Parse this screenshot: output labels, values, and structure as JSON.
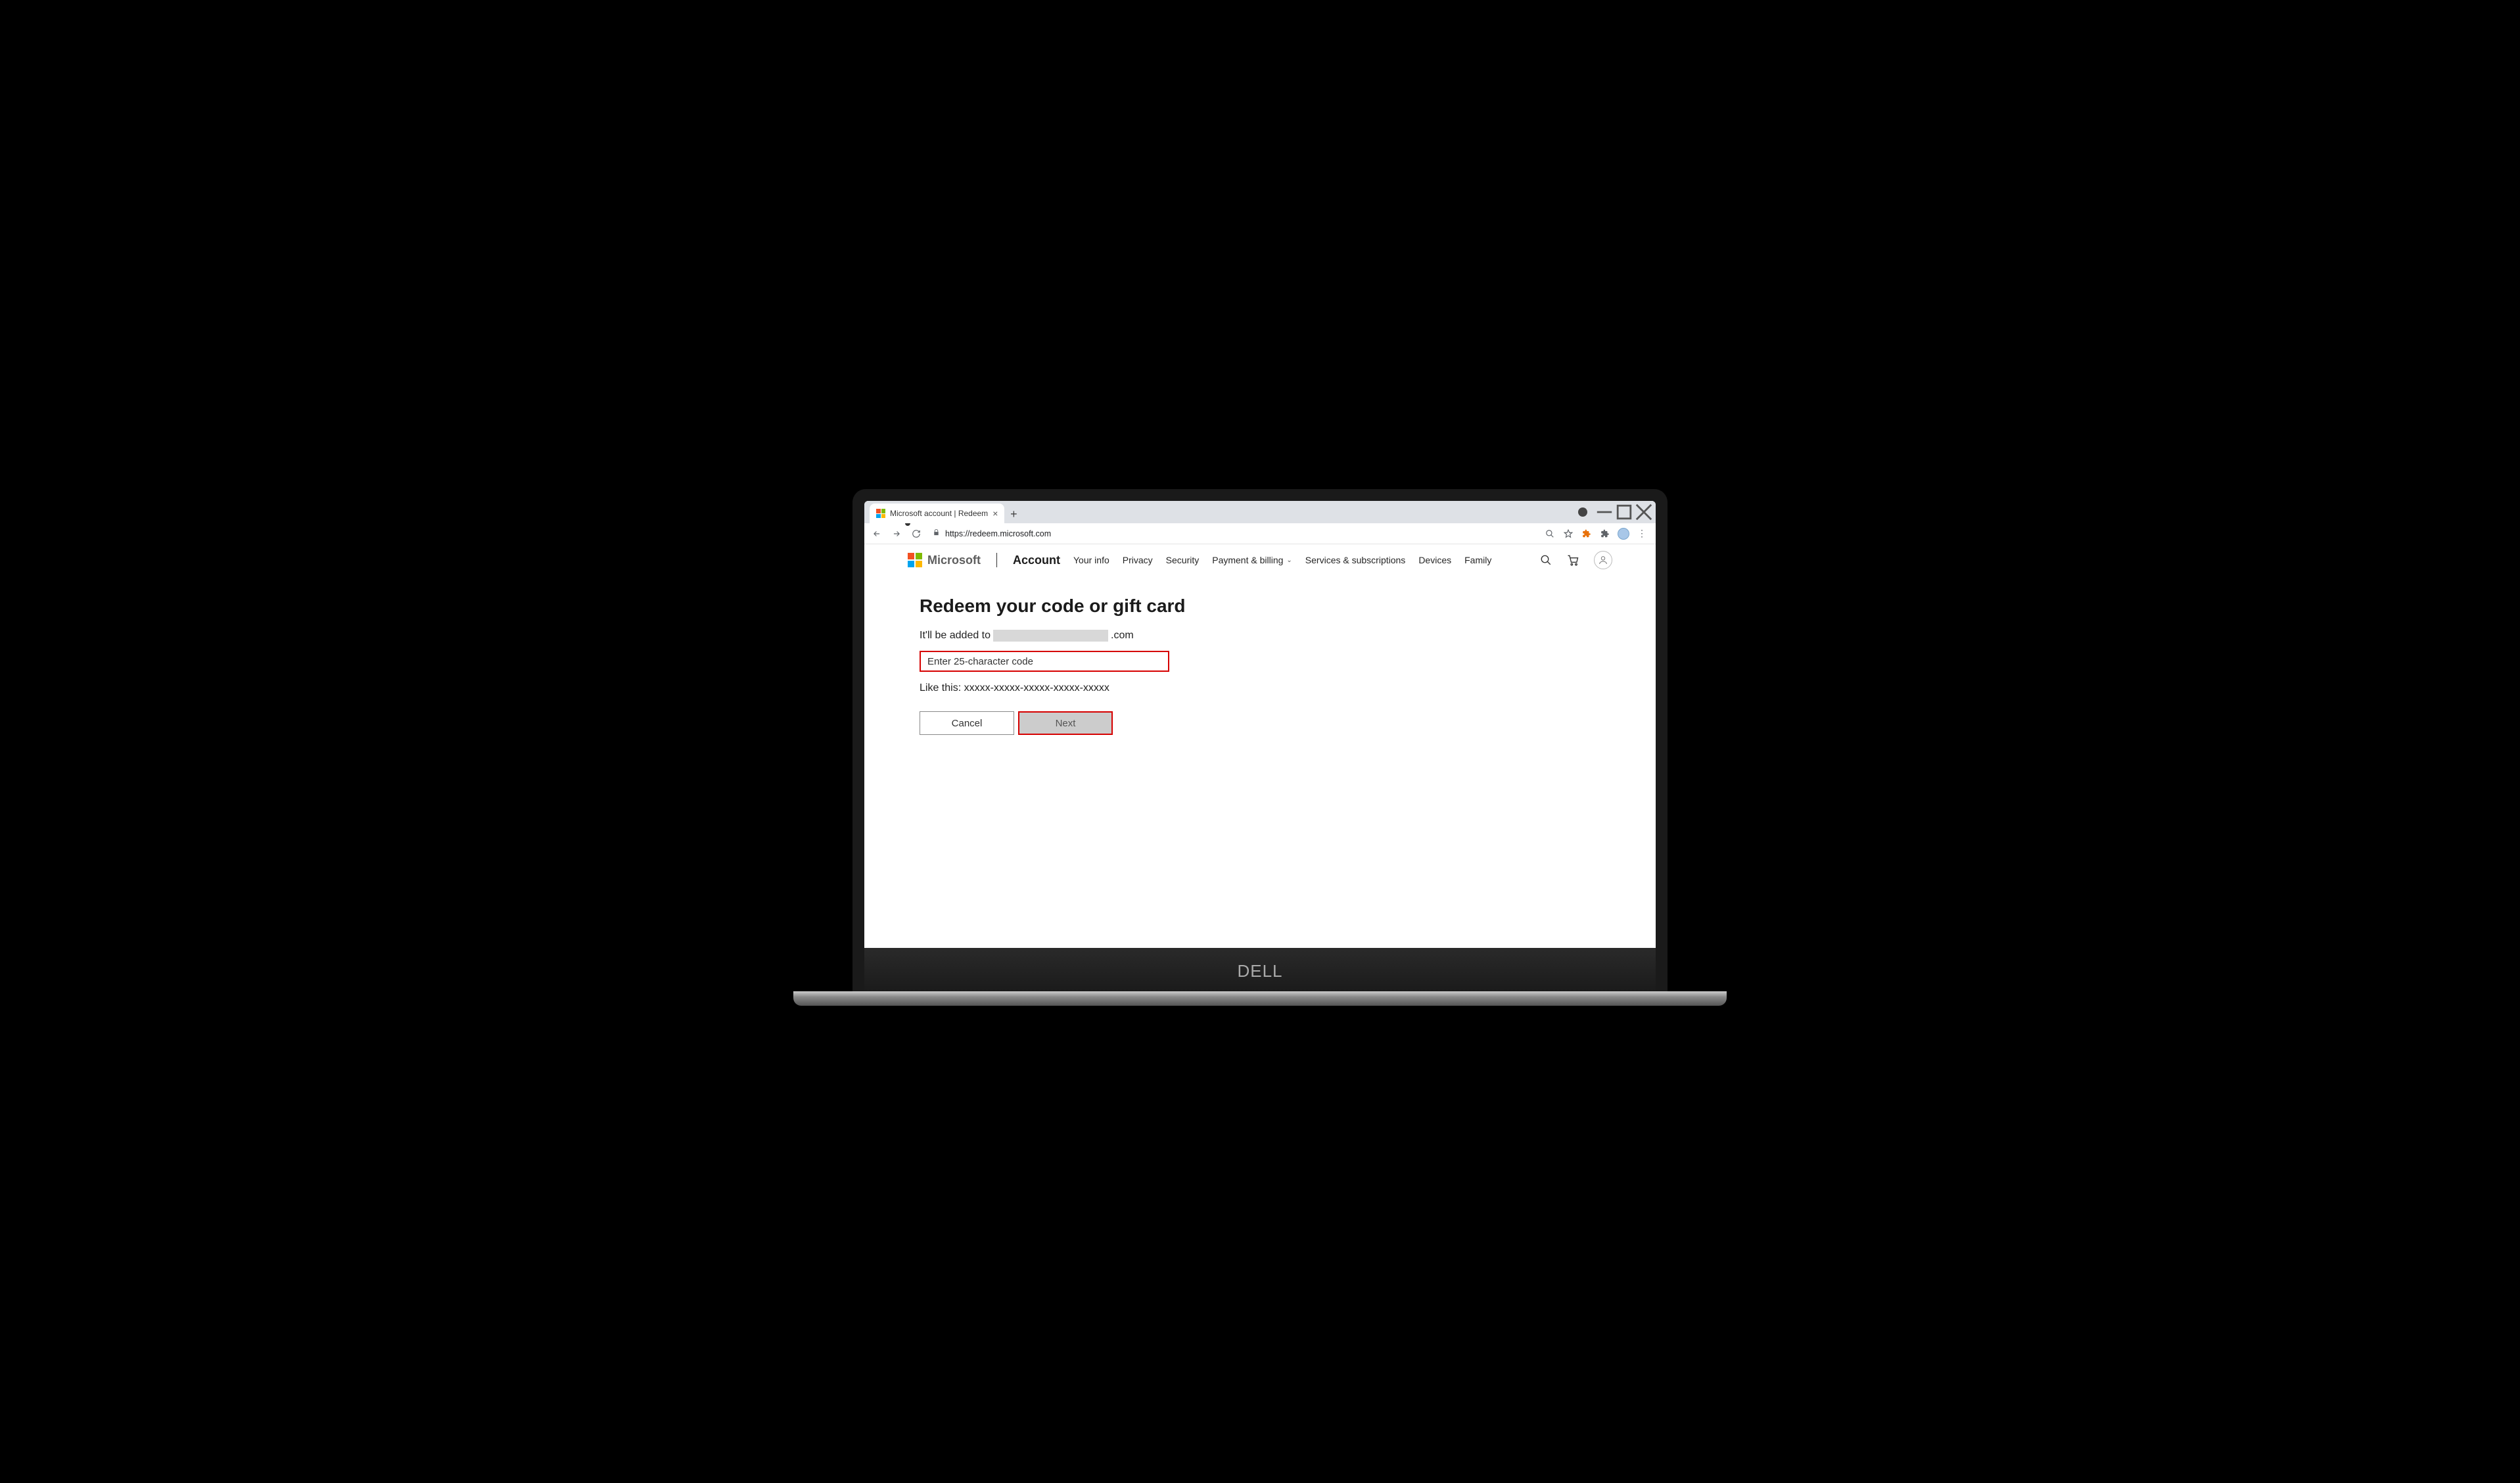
{
  "browser": {
    "tab_title": "Microsoft account | Redeem",
    "url_display": "https://redeem.microsoft.com"
  },
  "header": {
    "brand": "Microsoft",
    "primary": "Account",
    "nav": {
      "your_info": "Your info",
      "privacy": "Privacy",
      "security": "Security",
      "payment": "Payment & billing",
      "services": "Services & subscriptions",
      "devices": "Devices",
      "family": "Family"
    }
  },
  "main": {
    "title": "Redeem your code or gift card",
    "subtitle_prefix": "It'll be added to ",
    "subtitle_suffix": ".com",
    "code_placeholder": "Enter 25-character code",
    "hint": "Like this: xxxxx-xxxxx-xxxxx-xxxxx-xxxxx",
    "cancel_label": "Cancel",
    "next_label": "Next"
  },
  "laptop": {
    "brand": "DELL"
  }
}
